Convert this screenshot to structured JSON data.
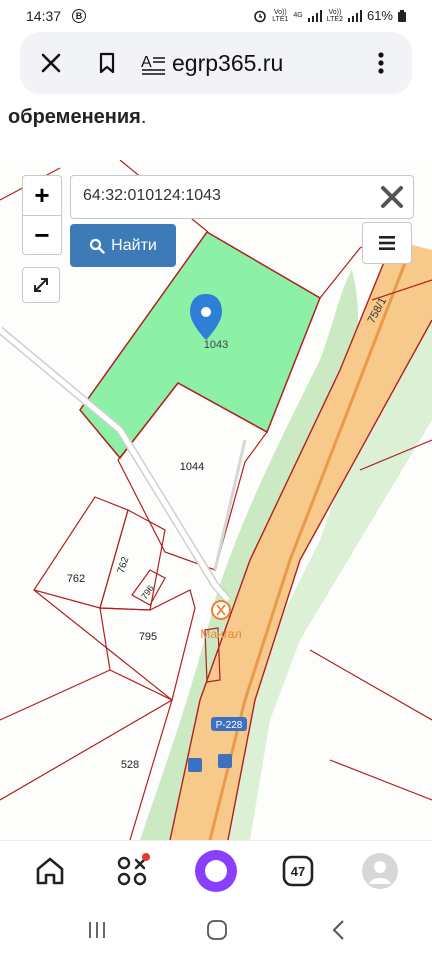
{
  "status_bar": {
    "time": "14:37",
    "b_badge": "B",
    "sim1": "Vo))\nLTE1",
    "net": "4G",
    "sim2": "Vo))\nLTE2",
    "battery": "61%"
  },
  "browser": {
    "url": "egrp365.ru",
    "icons": [
      "close-icon",
      "bookmark-icon",
      "reader-mode-icon",
      "more-vert-icon"
    ]
  },
  "page": {
    "heading_fragment": "обременения",
    "heading_punct": "."
  },
  "map": {
    "search_value": "64:32:010124:1043",
    "find_label": "Найти",
    "zoom_in": "+",
    "zoom_out": "−",
    "parcels": {
      "selected": "1043",
      "p1044": "1044",
      "p762a": "762",
      "p762b": "762",
      "p796": "796",
      "p795": "795",
      "p528": "528",
      "road": "758/1"
    },
    "poi_label": "Мангал",
    "road_sign": "Р-228",
    "selected_color": "#8cf0a6",
    "boundary_color": "#b02020",
    "road_color": "#f4b269",
    "marker_color": "#2f7fd6"
  },
  "bottom_nav": {
    "tabs_count": "47",
    "icons": [
      "home-icon",
      "services-icon",
      "alice-icon",
      "tabs-icon",
      "profile-icon"
    ]
  },
  "system_nav": {
    "icons": [
      "recent-apps-icon",
      "home-button-icon",
      "back-icon"
    ]
  }
}
